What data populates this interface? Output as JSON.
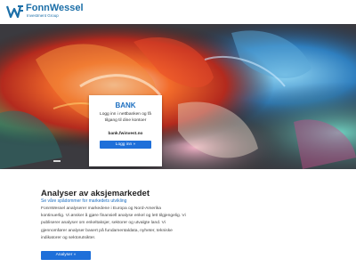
{
  "header": {
    "brand_name": "FonnWessel",
    "brand_sub": "Investment Group"
  },
  "login_card": {
    "title": "BANK",
    "description": "Logg inn i nettbanken og få tilgang til dine kontoer",
    "url": "bank.fwinvest.no",
    "button_label": "Logg inn »"
  },
  "section": {
    "title": "Analyser av aksjemarkedet",
    "subtitle": "Se våre spådommer for markedets utvikling",
    "lines": [
      "FonnWessel analyserer markedene i Europa og Nord-Amerika",
      "kontinuerlig. Vi ønsker å gjøre finansiell analyse enkel og lett tilgjengelig. Vi",
      "publiserer analyser om enkeltaksjer, sektorer og utvalgte land. Vi",
      "gjennomfører analyser basert på fundamentaldata, nyheter, tekniske",
      "indikatorer og sektorutsikter."
    ],
    "button_label": "Analyser »"
  },
  "colors": {
    "brand": "#1c6fa8",
    "accent": "#1e6fd9",
    "heading_blue": "#1d6fc0"
  }
}
